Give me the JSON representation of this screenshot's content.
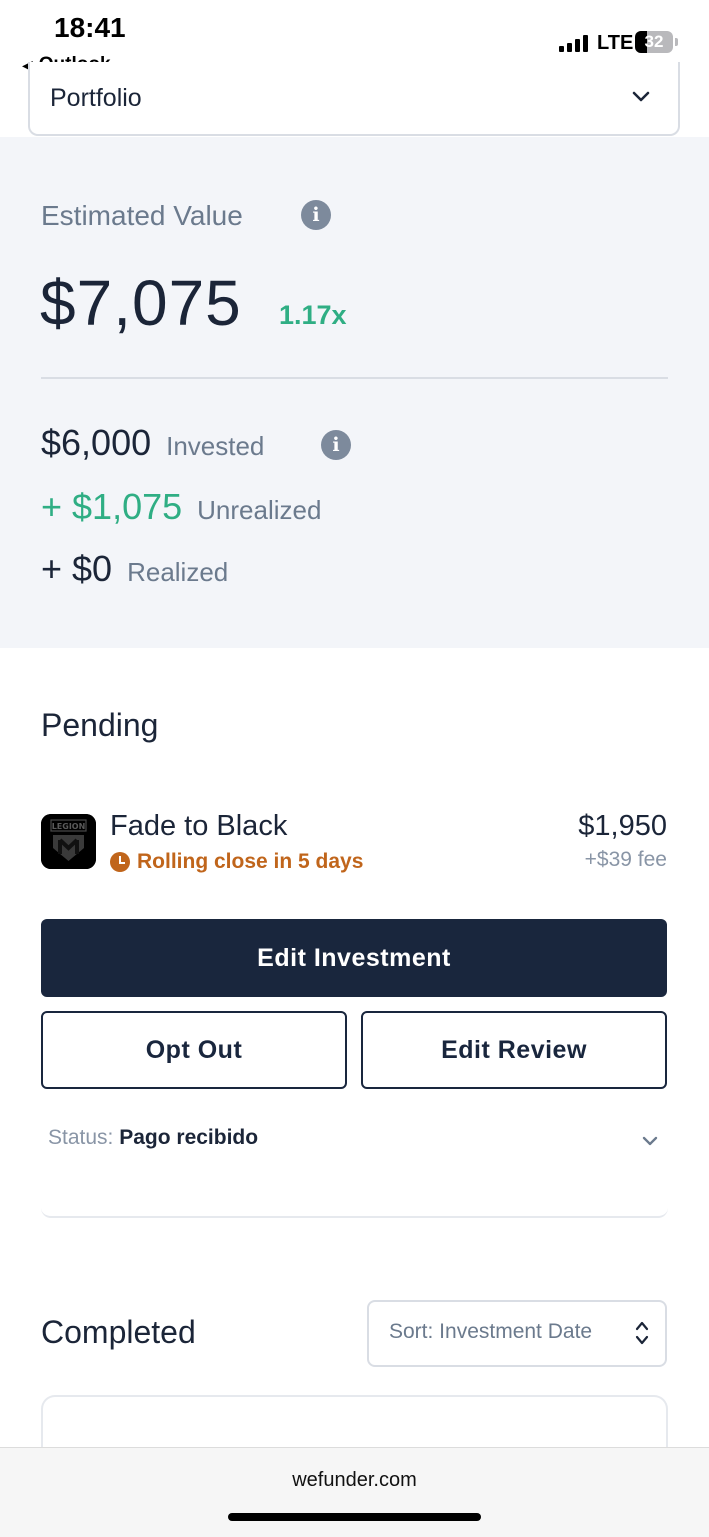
{
  "status_bar": {
    "time": "18:41",
    "back_app": "Outlook",
    "network": "LTE",
    "battery": "32",
    "battery_level": 0.32,
    "signal_icon": "signal-bars-icon"
  },
  "portfolio_select": {
    "value": "Portfolio",
    "icon": "chevron-down-icon"
  },
  "summary": {
    "estimated_label": "Estimated Value",
    "estimated_value": "$7,075",
    "multiple": "1.17x",
    "invested_amount": "$6,000",
    "invested_label": "Invested",
    "unrealized_amount": "+ $1,075",
    "unrealized_label": "Unrealized",
    "realized_amount": "+ $0",
    "realized_label": "Realized"
  },
  "pending": {
    "title": "Pending",
    "investment": {
      "name": "Fade to Black",
      "logo_text": "LEGION",
      "status": "Rolling close in 5 days",
      "amount": "$1,950",
      "fee": "+$39 fee"
    },
    "edit_investment_label": "Edit Investment",
    "opt_out_label": "Opt Out",
    "edit_review_label": "Edit Review",
    "status_key": "Status:",
    "status_value": "Pago recibido"
  },
  "completed": {
    "title": "Completed",
    "sort_label": "Sort: Investment Date"
  },
  "browser": {
    "url": "wefunder.com"
  },
  "colors": {
    "navy": "#19263d",
    "green": "#2fae84",
    "orange": "#c0651b",
    "panel_bg": "#f3f5f9"
  }
}
